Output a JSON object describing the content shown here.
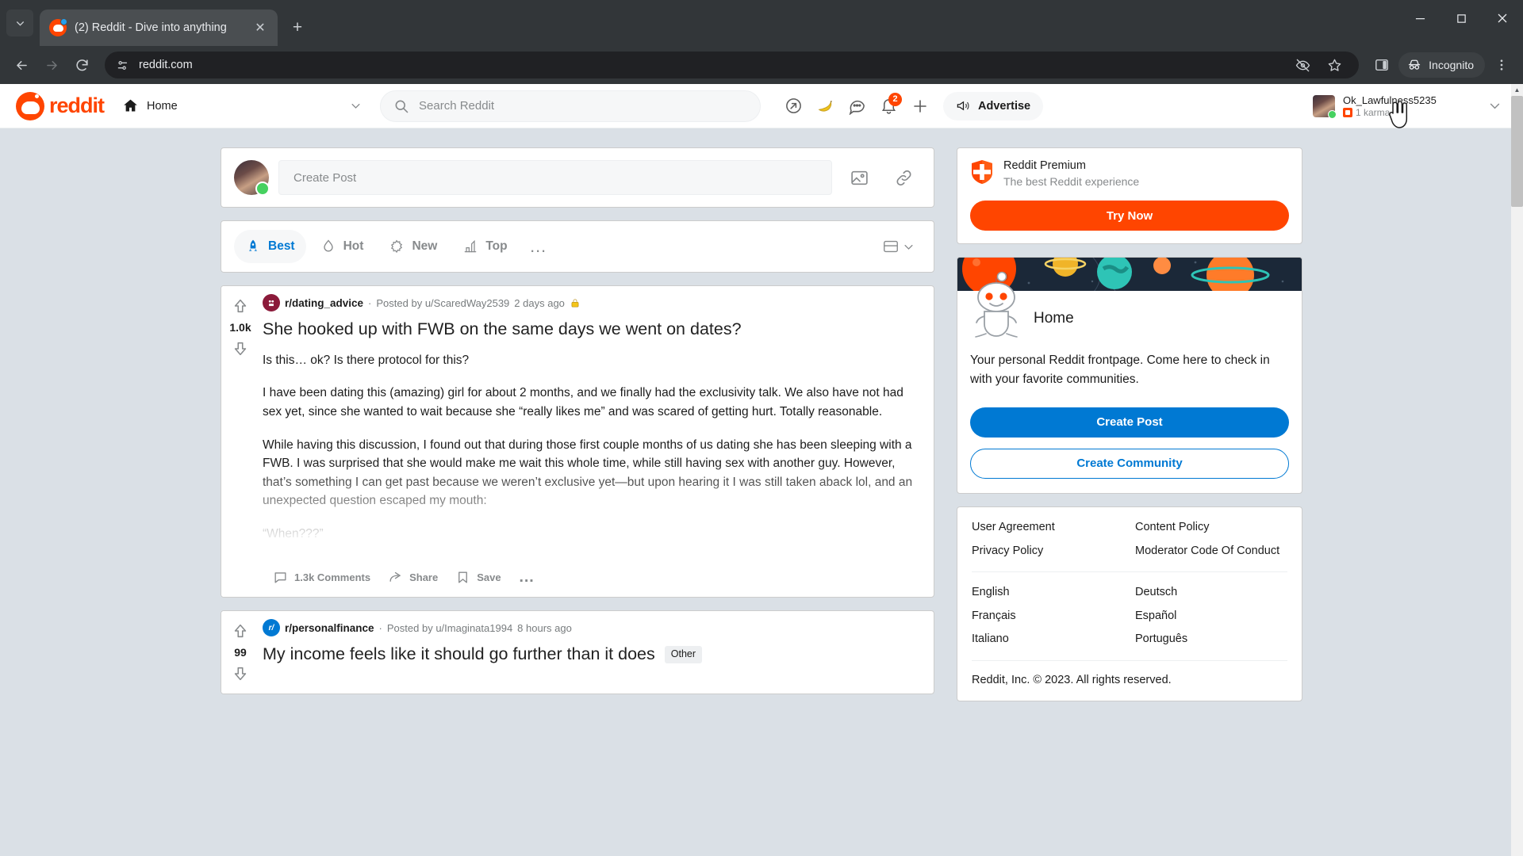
{
  "browser": {
    "tab": {
      "title": "(2) Reddit - Dive into anything",
      "favicon_icon": "reddit-favicon"
    },
    "newtab_label": "+",
    "tab_list_caret_icon": "chevron-down-icon",
    "window": {
      "minimize": "minimize-icon",
      "maximize": "maximize-icon",
      "close": "close-icon"
    },
    "nav": {
      "back_icon": "back-arrow-icon",
      "forward_icon": "forward-arrow-icon",
      "reload_icon": "reload-icon"
    },
    "omnibox": {
      "site_info_icon": "site-settings-icon",
      "url": "reddit.com"
    },
    "actions": {
      "tracking_icon": "eye-off-icon",
      "bookmark_icon": "star-icon",
      "sidepanel_icon": "side-panel-icon",
      "incognito_label": "Incognito",
      "incognito_icon": "incognito-hat-icon",
      "menu_icon": "three-dot-menu-icon"
    }
  },
  "reddit_header": {
    "logo_text": "reddit",
    "home_dropdown": {
      "icon": "home-icon",
      "label": "Home",
      "caret": "chevron-down-icon"
    },
    "search": {
      "icon": "search-icon",
      "placeholder": "Search Reddit",
      "value": ""
    },
    "icons": [
      {
        "name": "popular-icon",
        "glyph": "↗"
      },
      {
        "name": "banana-icon",
        "glyph": "🍌"
      },
      {
        "name": "chat-icon",
        "glyph": "💬"
      },
      {
        "name": "notifications-icon",
        "glyph": "🔔",
        "badge": "2"
      },
      {
        "name": "create-post-plus-icon",
        "glyph": "+"
      }
    ],
    "advertise": {
      "label": "Advertise",
      "icon": "megaphone-icon"
    },
    "user": {
      "name": "Ok_Lawfulness5235",
      "karma": "1 karma",
      "caret": "chevron-down-icon"
    }
  },
  "create_post_bar": {
    "placeholder": "Create Post",
    "image_icon": "image-icon",
    "link_icon": "link-icon"
  },
  "sort_bar": {
    "tabs": [
      {
        "label": "Best",
        "icon": "rocket-icon",
        "active": true
      },
      {
        "label": "Hot",
        "icon": "flame-icon",
        "active": false
      },
      {
        "label": "New",
        "icon": "sparkle-icon",
        "active": false
      },
      {
        "label": "Top",
        "icon": "chart-icon",
        "active": false
      }
    ],
    "more_label": "…",
    "view_icon": "layout-icon",
    "view_caret": "chevron-down-icon"
  },
  "posts": [
    {
      "subreddit": "r/dating_advice",
      "sub_initial": "",
      "sub_color": "#8b1a3a",
      "separator": "·",
      "posted_by": "Posted by u/ScaredWay2539",
      "age": "2 days ago",
      "lock_icon": "lock-icon",
      "votes": "1.0k",
      "upvote_icon": "upvote-arrow-icon",
      "downvote_icon": "downvote-arrow-icon",
      "title": "She hooked up with FWB on the same days we went on dates?",
      "flair": "",
      "body": [
        "Is this… ok? Is there protocol for this?",
        "I have been dating this (amazing) girl for about 2 months, and we finally had the exclusivity talk. We also have not had sex yet, since she wanted to wait because she “really likes me” and was scared of getting hurt. Totally reasonable.",
        "While having this discussion, I found out that during those first couple months of us dating she has been sleeping with a FWB. I was surprised that she would make me wait this whole time, while still having sex with another guy. However, that’s something I can get past because we weren’t exclusive yet—but upon hearing it I was still taken aback lol, and an unexpected question escaped my mouth:",
        "“When???”"
      ],
      "actions": {
        "comments": "1.3k Comments",
        "comments_icon": "comment-bubble-icon",
        "share": "Share",
        "share_icon": "share-arrow-icon",
        "save": "Save",
        "save_icon": "bookmark-icon",
        "more": "…"
      }
    },
    {
      "subreddit": "r/personalfinance",
      "sub_initial": "r/",
      "sub_color": "#0079d3",
      "separator": "·",
      "posted_by": "Posted by u/Imaginata1994",
      "age": "8 hours ago",
      "lock_icon": "",
      "votes": "99",
      "upvote_icon": "upvote-arrow-icon",
      "downvote_icon": "downvote-arrow-icon",
      "title": "My income feels like it should go further than it does",
      "flair": "Other",
      "body": [],
      "actions": {}
    }
  ],
  "sidebar": {
    "premium": {
      "icon": "premium-shield-icon",
      "title": "Reddit Premium",
      "subtitle": "The best Reddit experience",
      "cta": "Try Now"
    },
    "home_card": {
      "banner_icon": "planets-banner",
      "snoo_icon": "snoo-mascot-icon",
      "title": "Home",
      "description": "Your personal Reddit frontpage. Come here to check in with your favorite communities.",
      "create_post": "Create Post",
      "create_community": "Create Community"
    },
    "footer": {
      "links": [
        "User Agreement",
        "Content Policy",
        "Privacy Policy",
        "Moderator Code Of Conduct"
      ],
      "languages": [
        "English",
        "Deutsch",
        "Français",
        "Español",
        "Italiano",
        "Português"
      ],
      "copyright": "Reddit, Inc. © 2023. All rights reserved."
    }
  },
  "scrollbar": {
    "up_icon": "scroll-up-arrow",
    "down_icon": "scroll-down-arrow"
  },
  "colors": {
    "reddit_orange": "#ff4500",
    "reddit_blue": "#0079d3",
    "page_bg": "#dae0e6",
    "chrome_bg": "#323639"
  }
}
